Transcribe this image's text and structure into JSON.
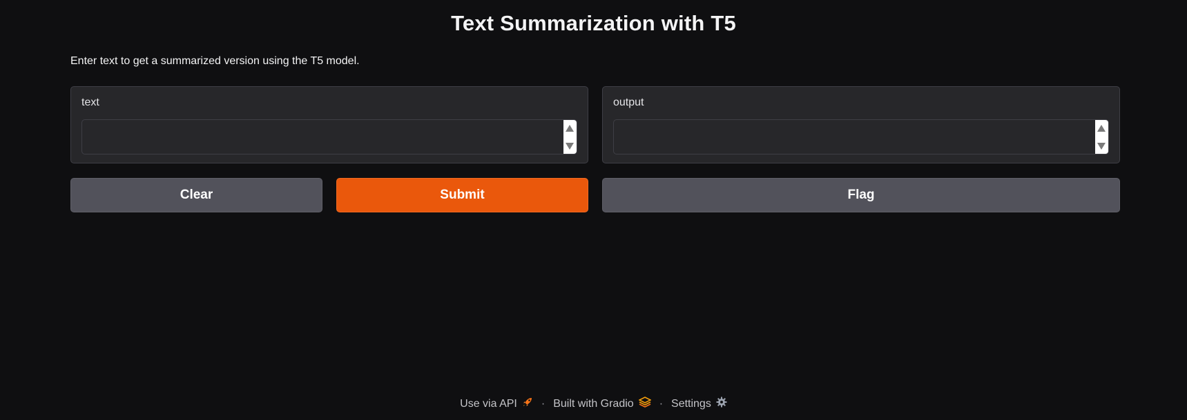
{
  "header": {
    "title": "Text Summarization with T5",
    "description": "Enter text to get a summarized version using the T5 model."
  },
  "input_panel": {
    "label": "text",
    "value": "",
    "placeholder": ""
  },
  "output_panel": {
    "label": "output",
    "value": ""
  },
  "buttons": {
    "clear": "Clear",
    "submit": "Submit",
    "flag": "Flag"
  },
  "footer": {
    "api_label": "Use via API",
    "gradio_label": "Built with Gradio",
    "settings_label": "Settings",
    "separator": "·",
    "icons": [
      "rocket-icon",
      "gradio-logo-icon",
      "gear-icon"
    ]
  },
  "colors": {
    "background": "#0f0f11",
    "panel": "#27272a",
    "accent": "#ea580c",
    "secondary_button": "#52525b"
  }
}
